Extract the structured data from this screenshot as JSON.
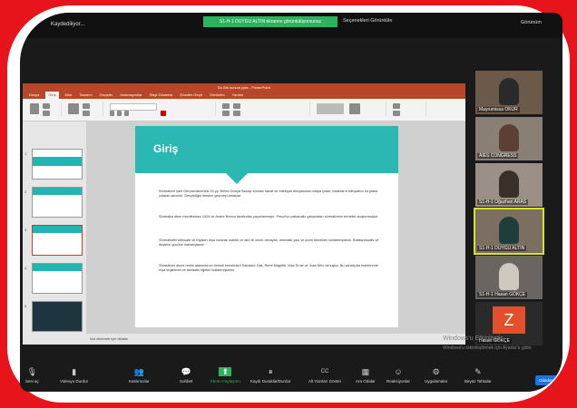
{
  "topbar": {
    "recording_label": "Kaydediliyor...",
    "share_banner": "S1-H-1 DUYGU ALTIN ekranını görüntülüyorsunuz",
    "view_options": "Seçenekleri Görüntüle",
    "view_mode": "Görünüm"
  },
  "ppt": {
    "titlebar": "Bu Biri sunum.pptx - PowerPoint",
    "tabs": [
      "Dosya",
      "Giriş",
      "Ekle",
      "Tasarım",
      "Geçişler",
      "Animasyonlar",
      "Slayt Gösterisi",
      "Gözden Geçir",
      "Görünüm",
      "Yardım"
    ],
    "active_tab": "Giriş",
    "status": "Not eklemek için tıklatın",
    "thumbnails": [
      "1",
      "2",
      "3",
      "4",
      "5"
    ],
    "thumb1_title": "GERÇEKÜSTÜCÜLÜK VE BÜTÜNLEŞME SANATI"
  },
  "slide": {
    "title": "Giriş",
    "p1": "Sürrealizm yani Gerçeküstücülük 20.yy. Birinci Dünya Savaşı sonrası sanat ve edebiyat dünyasında ortaya çıkan, insanların bilinçaltını ön plana çıkaran akımdır. Gerçekliğin ötesine geçmeyi amaçlar.",
    "p2": "Sürrealist akım manifestosu 1924 de Andre Breton tarafından yayınlanmıştır. Freud'un psikanaliz çalışmaları sürrealizmin temelini oluşturmuştur.",
    "p3": "Sürrealistler bilinçaltı ve rüyaları dışa vurarak mantık ve akıl ile sınırlı olmayan, otomatik yazı ve çizim teknikleri kullanmışlardır. Rastlantısallık ve düşlerin gücüne inanmışlardır.",
    "p4": "Sürrealizm akımı resim alanında en önemli temsilcileri Salvador Dali, Rene Magritte, Max Ernst ve Joan Miro olmuştur. Bu sanatçılar eserlerinde rüya imgelerini ve fantastik öğeleri kullanmışlardır."
  },
  "participants": [
    {
      "name": "Mayrumissa OKUR"
    },
    {
      "name": "AIES CONGRESS"
    },
    {
      "name": "S1-H-1 Oğuzhan ARAS"
    },
    {
      "name": "S1-H-1 DUYGU ALTIN"
    },
    {
      "name": "S1-H-1 Hasan GÖKÇE"
    },
    {
      "name": "Hasan GÖKÇE",
      "initial": "Z"
    }
  ],
  "watermark": {
    "line1": "Windows'u Etkinleştir",
    "line2": "Windows'u etkinleştirmek için Ayarlar'a gidin."
  },
  "bottombar": {
    "items": [
      {
        "label": "Sesi aç",
        "icon": "mic-muted-icon",
        "glyph": "🎙"
      },
      {
        "label": "Videoyu Durdur",
        "icon": "video-icon",
        "glyph": "▮"
      },
      {
        "label": "Katılımcılar",
        "icon": "participants-icon",
        "glyph": "👥"
      },
      {
        "label": "Sohbet",
        "icon": "chat-icon",
        "glyph": "💬"
      },
      {
        "label": "Ekran Paylaşımı",
        "icon": "share-screen-icon",
        "glyph": "⬆"
      },
      {
        "label": "Kaydı Duraklat/Durdur",
        "icon": "record-icon",
        "glyph": "⏸"
      },
      {
        "label": "Alt Yazıları Göster",
        "icon": "cc-icon",
        "glyph": "CC"
      },
      {
        "label": "Ara Odalar",
        "icon": "breakout-icon",
        "glyph": "▦"
      },
      {
        "label": "Reaksiyonlar",
        "icon": "reactions-icon",
        "glyph": "☺"
      },
      {
        "label": "Uygulamalar",
        "icon": "apps-icon",
        "glyph": "⚙"
      },
      {
        "label": "Beyaz Tahtalar",
        "icon": "whiteboard-icon",
        "glyph": "✎"
      }
    ],
    "end": "Odadan"
  }
}
